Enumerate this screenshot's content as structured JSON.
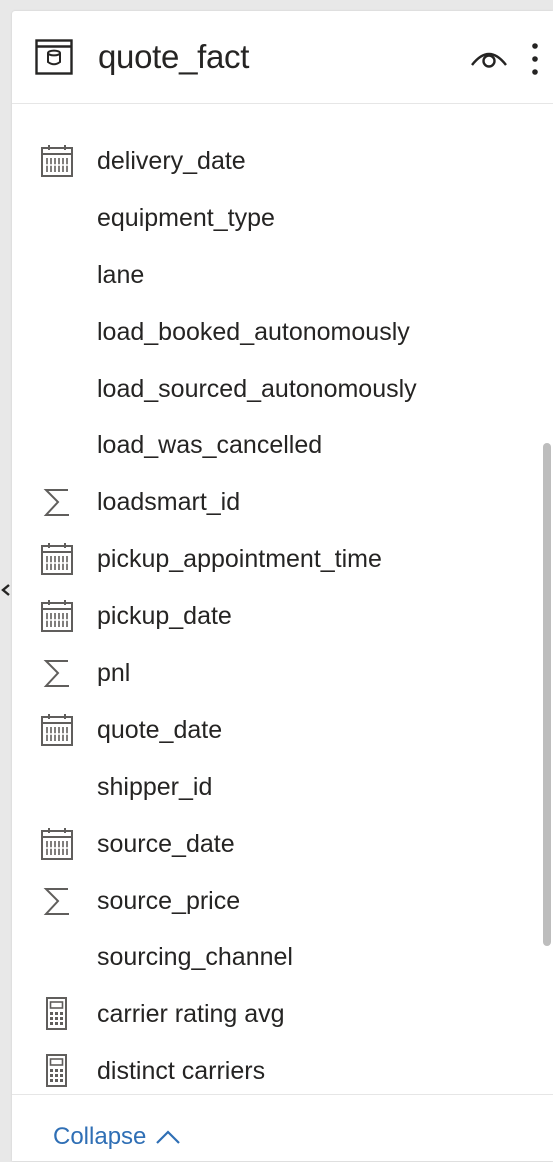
{
  "table": {
    "title": "quote_fact",
    "icon": "table-icon"
  },
  "header_actions": {
    "visibility_icon": "eye-icon",
    "more_icon": "more-options-icon"
  },
  "fields": [
    {
      "label": "delivery_date",
      "icon": "calendar-icon"
    },
    {
      "label": "equipment_type",
      "icon": ""
    },
    {
      "label": "lane",
      "icon": ""
    },
    {
      "label": "load_booked_autonomously",
      "icon": ""
    },
    {
      "label": "load_sourced_autonomously",
      "icon": ""
    },
    {
      "label": "load_was_cancelled",
      "icon": ""
    },
    {
      "label": "loadsmart_id",
      "icon": "sigma-icon"
    },
    {
      "label": "pickup_appointment_time",
      "icon": "calendar-icon"
    },
    {
      "label": "pickup_date",
      "icon": "calendar-icon"
    },
    {
      "label": "pnl",
      "icon": "sigma-icon"
    },
    {
      "label": "quote_date",
      "icon": "calendar-icon"
    },
    {
      "label": "shipper_id",
      "icon": ""
    },
    {
      "label": "source_date",
      "icon": "calendar-icon"
    },
    {
      "label": "source_price",
      "icon": "sigma-icon"
    },
    {
      "label": "sourcing_channel",
      "icon": ""
    },
    {
      "label": "carrier rating avg",
      "icon": "calculator-icon"
    },
    {
      "label": "distinct carriers",
      "icon": "calculator-icon"
    }
  ],
  "footer": {
    "collapse_label": "Collapse",
    "collapse_icon": "chevron-up-icon"
  },
  "side_toggle": {
    "icon": "chevron-left-icon"
  },
  "colors": {
    "link": "#2f6fb5",
    "text": "#252423",
    "icon": "#605e5c",
    "background": "#e8e8e8",
    "panel": "#ffffff",
    "scrollbar": "#bdbdbd"
  }
}
